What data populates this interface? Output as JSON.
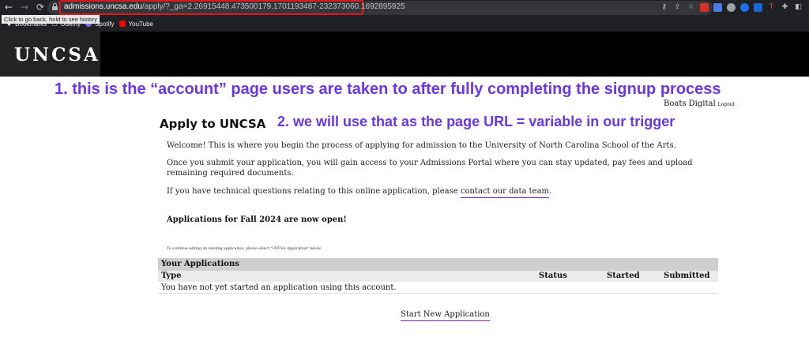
{
  "browser": {
    "url_host": "admissions.uncsa.edu",
    "url_path": "/apply/?_ga=2.26915448.473500179.1701193487-232373060.1692895925",
    "tooltip": "Click to go back, hold to see history",
    "bookmarks": [
      {
        "label": "Bookmarks",
        "icon": "star-icon"
      },
      {
        "label": "Udemy",
        "icon": "folder-icon"
      },
      {
        "label": "Spotify",
        "icon": "spotify-icon",
        "color": "#7c6cf0"
      },
      {
        "label": "YouTube",
        "icon": "youtube-icon",
        "color": "#ff0000"
      }
    ]
  },
  "site": {
    "logo": "UNCSA"
  },
  "annotations": {
    "line1": "1. this is the “account” page users are taken to after fully completing the signup process",
    "line2": "2. we will use that as the page URL = variable in our trigger",
    "color": "#6b35e8"
  },
  "user": {
    "name": "Boats Digital",
    "logout": "Logout"
  },
  "page": {
    "title": "Apply to UNCSA",
    "welcome": "Welcome! This is where you begin the process of applying for admission to the University of North Carolina School of the Arts.",
    "submit_info": "Once you submit your application, you will gain access to your Admissions Portal where you can stay updated, pay fees and upload remaining required documents.",
    "tech_prefix": "If you have technical questions relating to this online application, please ",
    "tech_link": "contact our data team",
    "tech_suffix": ".",
    "fall_notice": "Applications for Fall 2024 are now open!",
    "continue_note": "To continue editing an existing application, please select \"UNCSA Application\" below."
  },
  "applications": {
    "heading": "Your Applications",
    "columns": [
      "Type",
      "Status",
      "Started",
      "Submitted"
    ],
    "empty_message": "You have not yet started an application using this account.",
    "start_new": "Start New Application"
  }
}
